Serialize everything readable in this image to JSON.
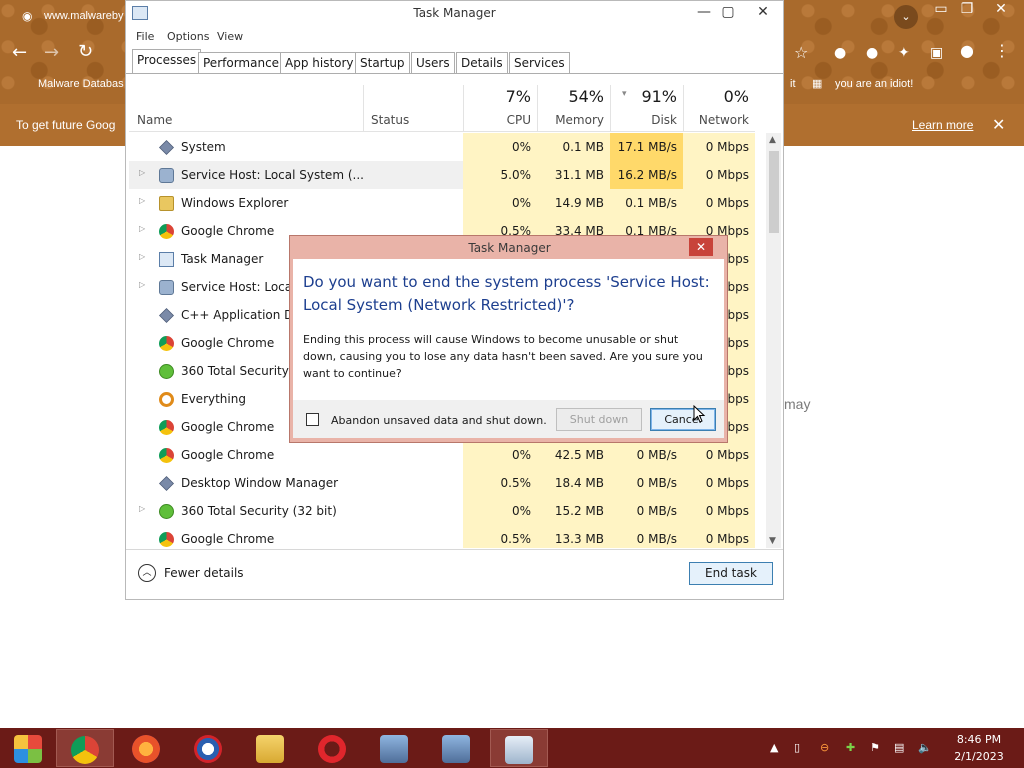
{
  "browser": {
    "address": "www.malwareby",
    "bookmark_left": "Malware Databas",
    "bookmark_right_fragment": "it",
    "bookmark_right": "you are an idiot!",
    "infobar_text": "To get future Goog",
    "infobar_link": "Learn more",
    "page_snippet": "may"
  },
  "taskmanager": {
    "title": "Task Manager",
    "menu": [
      "File",
      "Options",
      "View"
    ],
    "tabs": [
      "Processes",
      "Performance",
      "App history",
      "Startup",
      "Users",
      "Details",
      "Services"
    ],
    "columns": {
      "name": "Name",
      "status": "Status",
      "cpu": {
        "pct": "7%",
        "label": "CPU"
      },
      "memory": {
        "pct": "54%",
        "label": "Memory"
      },
      "disk": {
        "pct": "91%",
        "label": "Disk"
      },
      "network": {
        "pct": "0%",
        "label": "Network"
      }
    },
    "processes": [
      {
        "name": "System",
        "icon": "system-icon",
        "expandable": false,
        "cpu": "0%",
        "memory": "0.1 MB",
        "disk": "17.1 MB/s",
        "network": "0 Mbps"
      },
      {
        "name": "Service Host: Local System (...",
        "icon": "gear-icon",
        "expandable": true,
        "cpu": "5.0%",
        "memory": "31.1 MB",
        "disk": "16.2 MB/s",
        "network": "0 Mbps"
      },
      {
        "name": "Windows Explorer",
        "icon": "folder-icon",
        "expandable": true,
        "cpu": "0%",
        "memory": "14.9 MB",
        "disk": "0.1 MB/s",
        "network": "0 Mbps"
      },
      {
        "name": "Google Chrome",
        "icon": "chrome-icon",
        "expandable": true,
        "cpu": "0.5%",
        "memory": "33.4 MB",
        "disk": "0.1 MB/s",
        "network": "0 Mbps"
      },
      {
        "name": "Task Manager",
        "icon": "taskmanager-icon",
        "expandable": true,
        "cpu": "",
        "memory": "",
        "disk": "",
        "network": "Mbps"
      },
      {
        "name": "Service Host: Local",
        "icon": "gear-icon",
        "expandable": true,
        "cpu": "",
        "memory": "",
        "disk": "",
        "network": "Mbps"
      },
      {
        "name": "C++ Application Dev",
        "icon": "system-icon",
        "expandable": false,
        "cpu": "",
        "memory": "",
        "disk": "",
        "network": "Mbps"
      },
      {
        "name": "Google Chrome",
        "icon": "chrome-icon",
        "expandable": false,
        "cpu": "",
        "memory": "",
        "disk": "",
        "network": "Mbps"
      },
      {
        "name": "360 Total Security",
        "icon": "security-icon",
        "expandable": false,
        "cpu": "",
        "memory": "",
        "disk": "",
        "network": "Mbps"
      },
      {
        "name": "Everything",
        "icon": "search-icon",
        "expandable": false,
        "cpu": "",
        "memory": "",
        "disk": "",
        "network": "Mbps"
      },
      {
        "name": "Google Chrome",
        "icon": "chrome-icon",
        "expandable": false,
        "cpu": "",
        "memory": "",
        "disk": "",
        "network": "Mbps"
      },
      {
        "name": "Google Chrome",
        "icon": "chrome-icon",
        "expandable": false,
        "cpu": "0%",
        "memory": "42.5 MB",
        "disk": "0 MB/s",
        "network": "0 Mbps"
      },
      {
        "name": "Desktop Window Manager",
        "icon": "system-icon",
        "expandable": false,
        "cpu": "0.5%",
        "memory": "18.4 MB",
        "disk": "0 MB/s",
        "network": "0 Mbps"
      },
      {
        "name": "360 Total Security (32 bit)",
        "icon": "security-icon",
        "expandable": true,
        "cpu": "0%",
        "memory": "15.2 MB",
        "disk": "0 MB/s",
        "network": "0 Mbps"
      },
      {
        "name": "Google Chrome",
        "icon": "chrome-icon",
        "expandable": false,
        "cpu": "0.5%",
        "memory": "13.3 MB",
        "disk": "0 MB/s",
        "network": "0 Mbps"
      }
    ],
    "fewer_details": "Fewer details",
    "end_task": "End task"
  },
  "dialog": {
    "title": "Task Manager",
    "close": "✕",
    "heading": "Do you want to end the system process 'Service Host: Local System (Network Restricted)'?",
    "message": "Ending this process will cause Windows to become unusable or shut down, causing you to lose any data hasn't been saved. Are you sure you want to continue?",
    "checkbox_label": "Abandon unsaved data and shut down.",
    "shutdown_button": "Shut down",
    "cancel_button": "Cancel"
  },
  "taskbar": {
    "apps": [
      "start-icon",
      "chrome-icon",
      "firefox-icon",
      "obama-icon",
      "folder-icon",
      "opera-icon",
      "network-icon",
      "network-icon",
      "taskmanager-icon"
    ],
    "clock_time": "8:46 PM",
    "clock_date": "2/1/2023"
  },
  "colors": {
    "disk_hot": "#ffd96a",
    "cell_bg": "#fff4c4",
    "dialog_heading": "#1d3f8f",
    "taskbar": "#6b1b17"
  }
}
